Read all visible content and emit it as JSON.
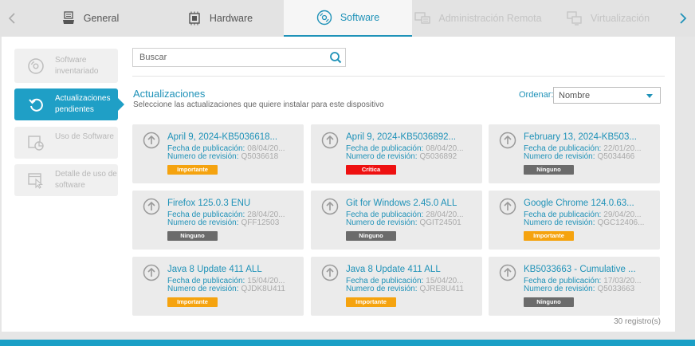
{
  "tabs": [
    {
      "label": "General",
      "icon": "server-icon",
      "state": "normal"
    },
    {
      "label": "Hardware",
      "icon": "chip-icon",
      "state": "normal"
    },
    {
      "label": "Software",
      "icon": "disc-icon",
      "state": "active"
    },
    {
      "label": "Administración Remota",
      "icon": "remote-admin-icon",
      "state": "disabled"
    },
    {
      "label": "Virtualización",
      "icon": "virtualization-icon",
      "state": "disabled"
    }
  ],
  "sidebar": {
    "items": [
      {
        "label": "Software inventariado",
        "icon": "disc-icon",
        "active": false
      },
      {
        "label": "Actualizaciones pendientes",
        "icon": "refresh-icon",
        "active": true
      },
      {
        "label": "Uso de Software",
        "icon": "chart-icon",
        "active": false
      },
      {
        "label": "Detalle de uso de software",
        "icon": "window-cursor-icon",
        "active": false
      }
    ]
  },
  "search": {
    "placeholder": "Buscar"
  },
  "header": {
    "title": "Actualizaciones",
    "subtitle": "Seleccione las actualizaciones que quiere instalar para este dispositivo"
  },
  "sort": {
    "label": "Ordenar:",
    "value": "Nombre"
  },
  "fields": {
    "date_label": "Fecha de publicación:",
    "revision_label": "Numero de revisión:"
  },
  "updates": [
    {
      "title": "April 9, 2024-KB5036618...",
      "date": "08/04/20...",
      "revision": "Q5036618",
      "severity": "Importante"
    },
    {
      "title": "April 9, 2024-KB5036892...",
      "date": "08/04/20...",
      "revision": "Q5036892",
      "severity": "Crítica"
    },
    {
      "title": "February 13, 2024-KB503...",
      "date": "22/01/20...",
      "revision": "Q5034466",
      "severity": "Ninguno"
    },
    {
      "title": "Firefox 125.0.3 ENU",
      "date": "28/04/20...",
      "revision": "QFF12503",
      "severity": "Ninguno"
    },
    {
      "title": "Git for Windows 2.45.0 ALL",
      "date": "28/04/20...",
      "revision": "QGIT24501",
      "severity": "Ninguno"
    },
    {
      "title": "Google Chrome 124.0.63...",
      "date": "29/04/20...",
      "revision": "QGC12406...",
      "severity": "Importante"
    },
    {
      "title": "Java 8 Update 411 ALL",
      "date": "15/04/20...",
      "revision": "QJDK8U411",
      "severity": "Importante"
    },
    {
      "title": "Java 8 Update 411 ALL",
      "date": "15/04/20...",
      "revision": "QJRE8U411",
      "severity": "Importante"
    },
    {
      "title": "KB5033663 - Cumulative ...",
      "date": "17/03/20...",
      "revision": "Q5033663",
      "severity": "Ninguno"
    }
  ],
  "footer": {
    "records": "30 registro(s)"
  },
  "colors": {
    "accent": "#1f9fc6",
    "importante": "#f5a30f",
    "critica": "#ee1111",
    "ninguno": "#6b6b6b"
  }
}
